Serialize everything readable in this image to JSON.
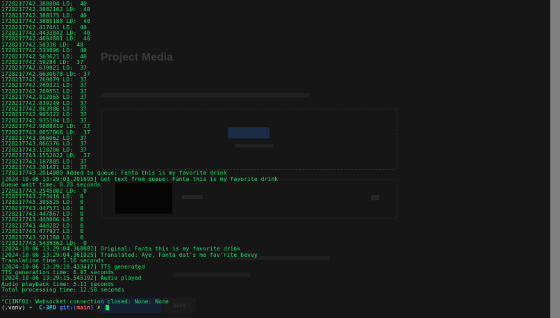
{
  "background_page": {
    "section_title": "Project Media",
    "bottom_button": "Save"
  },
  "terminal": {
    "lines": [
      "1728217742.388004 LD:  40",
      "1728217742.3882102 LD:  40",
      "1728217742.388375 LD:  40",
      "1728217742.3885188 LD:  40",
      "1728217742.417461 LD:  40",
      "1728217742.4433842 LD:  40",
      "1728217742.4694881 LD:  40",
      "1728217742.50318 LD:  40",
      "1728217742.533896 LD:  40",
      "1728217742.563621 LD:  40",
      "1728217742.59284 LD:  37",
      "1728217742.639821 LD:  37",
      "1728217742.6630678 LD:  37",
      "1728217742.769079 LD:  37",
      "1728217742.769321 LD:  37",
      "1728217742.769551 LD:  37",
      "1728217742.812065 LD:  37",
      "1728217742.839249 LD:  37",
      "1728217742.863986 LD:  37",
      "1728217742.905322 LD:  37",
      "1728217742.935194 LD:  37",
      "1728217742.9808419 LD:  37",
      "1728217743.0657868 LD:  37",
      "1728217743.066062 LD:  37",
      "1728217743.066376 LD:  37",
      "1728217743.118206 LD:  37",
      "1728217743.1552022 LD:  37",
      "1728217743.187885 LD:  37",
      "1728217743.201421 LD:  37",
      "1728217743.2014889 Added to queue: Fanta this is my favorite drink",
      "[2024-10-06 13:29:03.201695] Got text from queue: Fanta this is my favorite drink",
      "Queue wait time: 0.23 seconds",
      "1728217743.2545002 LD:  0",
      "1728217743.273416 LD:  0",
      "1728217743.305525 LD:  0",
      "1728217743.447571 LD:  0",
      "1728217743.447867 LD:  0",
      "1728217743.448066 LD:  0",
      "1728217743.448282 LD:  0",
      "1728217743.477927 LD:  0",
      "1728217743.521188 LD:  0",
      "1728217743.5435362 LD:  0",
      "[2024-10-06 13:29:04.360981] Original: Fanta this is my favorite drink",
      "[2024-10-06 13:29:04.361025] Translated: Aye, Fanta dat's me fav'rite bevvy",
      "Translation time: 1.16 seconds",
      "[2024-10-06 13:29:10.433417] TTS generated",
      "TTS generation time: 6.07 seconds",
      "[2024-10-06 13:29:15.545192] Audio played",
      "Audio playback time: 5.11 seconds",
      "Total processing time: 12.58 seconds",
      "---",
      "^C[INFO]: Websocket connection closed: None: None"
    ],
    "prompt": {
      "venv": "(.venv)",
      "arrow": "➜",
      "dir": "C-3PO",
      "git_prefix": "git:(",
      "branch": "main",
      "git_suffix": ")",
      "mark": "✗"
    }
  },
  "colors": {
    "terminal_text": "#22e06e",
    "background": "#0e0e0e"
  }
}
